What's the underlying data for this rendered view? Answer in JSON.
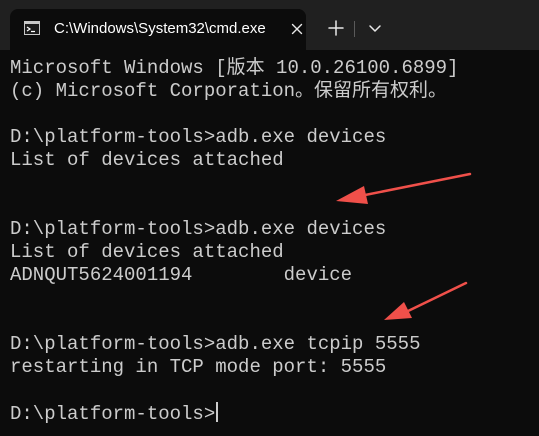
{
  "tab": {
    "title": "C:\\Windows\\System32\\cmd.exe",
    "icon": "cmd-icon"
  },
  "tabstrip": {
    "close_icon": "close-icon",
    "new_tab_label": "+",
    "dropdown_icon": "chevron-down-icon"
  },
  "console": {
    "lines": [
      "Microsoft Windows [版本 10.0.26100.6899]",
      "(c) Microsoft Corporation。保留所有权利。",
      "",
      "D:\\platform-tools>adb.exe devices",
      "List of devices attached",
      "",
      "",
      "D:\\platform-tools>adb.exe devices",
      "List of devices attached",
      "ADNQUT5624001194        device",
      "",
      "",
      "D:\\platform-tools>adb.exe tcpip 5555",
      "restarting in TCP mode port: 5555",
      "",
      "D:\\platform-tools>"
    ]
  },
  "colors": {
    "background": "#0c0c0c",
    "titlebar": "#202020",
    "text": "#cccccc",
    "arrow": "#f0504a"
  }
}
